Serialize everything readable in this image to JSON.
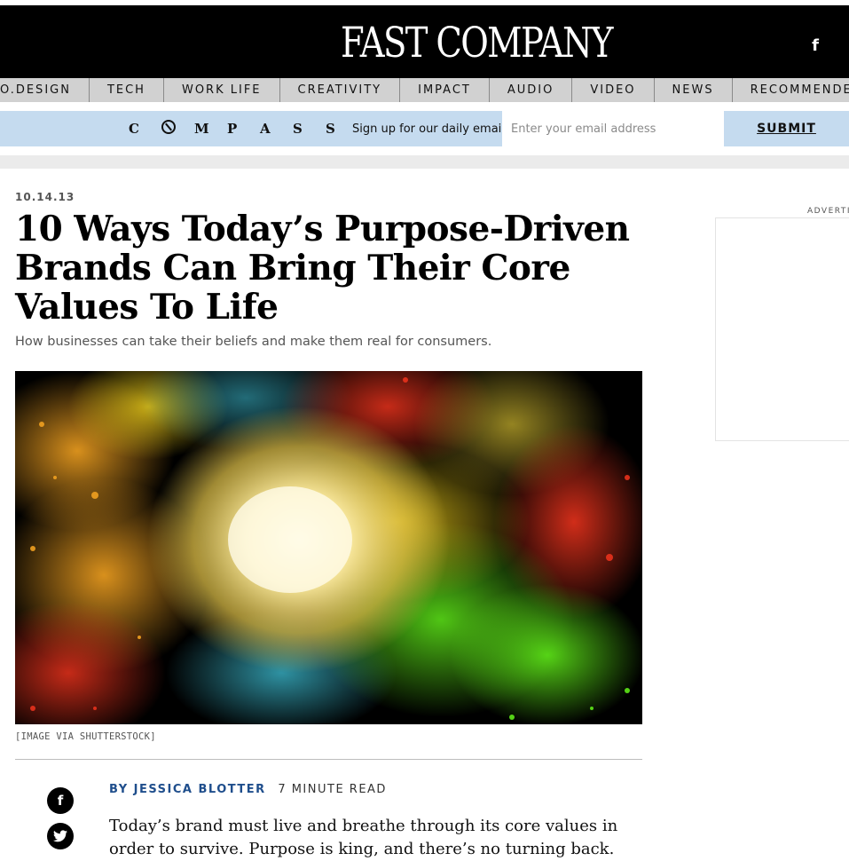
{
  "header": {
    "logo_text": "FAST COMPANY",
    "facebook_icon": "f"
  },
  "nav": {
    "items": [
      "O.DESIGN",
      "TECH",
      "WORK LIFE",
      "CREATIVITY",
      "IMPACT",
      "AUDIO",
      "VIDEO",
      "NEWS",
      "RECOMMENDER"
    ]
  },
  "newsletter": {
    "brand": "COMPASS",
    "signup_text": "Sign up for our daily email.",
    "email_placeholder": "Enter your email address",
    "submit_label": "SUBMIT"
  },
  "article": {
    "date": "10.14.13",
    "headline": "10 Ways Today’s Purpose-Driven Brands Can Bring Their Core Values To Life",
    "dek": "How businesses can take their beliefs and make them real for consumers.",
    "image_caption": "[IMAGE VIA SHUTTERSTOCK]",
    "byline_author": "BY JESSICA BLOTTER",
    "read_time": "7 MINUTE READ",
    "body_lead": "Today’s brand must live and breathe through its core values in order to survive. Purpose is king, and there’s no turning back."
  },
  "share": {
    "facebook_icon": "f",
    "twitter_icon": "twitter-bird"
  },
  "sidebar": {
    "ad_label": "ADVERTI"
  },
  "colors": {
    "header_bg": "#000000",
    "nav_bg": "#d1d1d1",
    "newsletter_bg": "#c5dbef",
    "byline_link": "#1f4e8c"
  }
}
